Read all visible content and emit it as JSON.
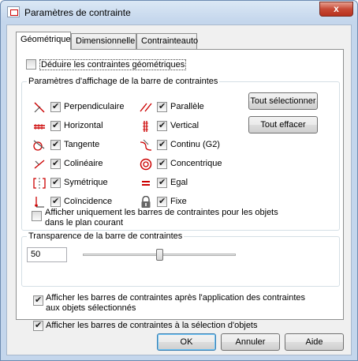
{
  "window": {
    "title": "Paramètres de contrainte",
    "close_glyph": "x"
  },
  "tabs": [
    {
      "label": "Géométrique",
      "active": true
    },
    {
      "label": "Dimensionnelle",
      "active": false
    },
    {
      "label": "Contrainteauto",
      "active": false
    }
  ],
  "infer": {
    "label": "Déduire les contraintes géométriques",
    "checked": false
  },
  "display_group": {
    "title": "Paramètres d'affichage de la barre de contraintes",
    "left": [
      {
        "label": "Perpendiculaire",
        "icon": "perpendicular-icon",
        "checked": true
      },
      {
        "label": "Horizontal",
        "icon": "horizontal-icon",
        "checked": true
      },
      {
        "label": "Tangente",
        "icon": "tangent-icon",
        "checked": true
      },
      {
        "label": "Colinéaire",
        "icon": "collinear-icon",
        "checked": true
      },
      {
        "label": "Symétrique",
        "icon": "symmetric-icon",
        "checked": true
      },
      {
        "label": "Coïncidence",
        "icon": "coincident-icon",
        "checked": true
      }
    ],
    "right": [
      {
        "label": "Parallèle",
        "icon": "parallel-icon",
        "checked": true
      },
      {
        "label": "Vertical",
        "icon": "vertical-icon",
        "checked": true
      },
      {
        "label": "Continu (G2)",
        "icon": "smooth-icon",
        "checked": true
      },
      {
        "label": "Concentrique",
        "icon": "concentric-icon",
        "checked": true
      },
      {
        "label": "Egal",
        "icon": "equal-icon",
        "checked": true
      },
      {
        "label": "Fixe",
        "icon": "lock-icon",
        "checked": true
      }
    ],
    "select_all": "Tout sélectionner",
    "clear_all": "Tout effacer",
    "current_plane": {
      "label_line1": "Afficher uniquement les barres de contraintes pour les objets",
      "label_line2": "dans le plan courant",
      "checked": false
    }
  },
  "transparency": {
    "title": "Transparence de la barre de contraintes",
    "value": "50",
    "slider_fraction": 0.5
  },
  "after_apply": {
    "label_line1": "Afficher les barres de contraintes après l'application des contraintes",
    "label_line2": "aux objets sélectionnés",
    "checked": true
  },
  "on_select": {
    "label": "Afficher les barres de contraintes à la sélection d'objets",
    "checked": true
  },
  "buttons": {
    "ok": "OK",
    "cancel": "Annuler",
    "help": "Aide"
  }
}
